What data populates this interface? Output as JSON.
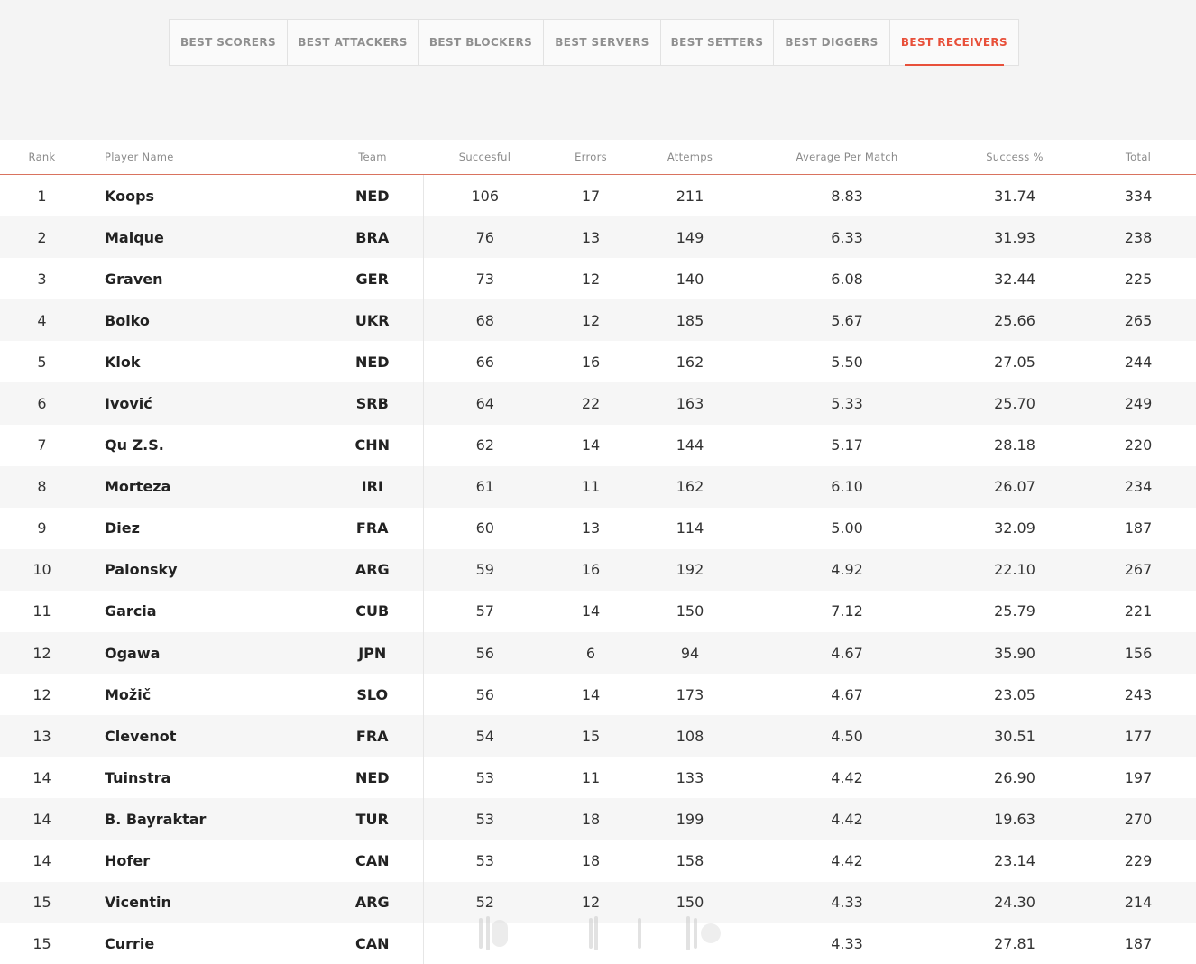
{
  "tabs": [
    {
      "label": "BEST SCORERS",
      "active": false
    },
    {
      "label": "BEST ATTACKERS",
      "active": false
    },
    {
      "label": "BEST BLOCKERS",
      "active": false
    },
    {
      "label": "BEST SERVERS",
      "active": false
    },
    {
      "label": "BEST SETTERS",
      "active": false
    },
    {
      "label": "BEST DIGGERS",
      "active": false
    },
    {
      "label": "BEST RECEIVERS",
      "active": true
    }
  ],
  "table": {
    "headers": {
      "rank": "Rank",
      "player": "Player Name",
      "team": "Team",
      "successful": "Succesful",
      "errors": "Errors",
      "attempts": "Attemps",
      "average": "Average Per Match",
      "success_pct": "Success %",
      "total": "Total"
    },
    "rows": [
      {
        "rank": "1",
        "player": "Koops",
        "team": "NED",
        "successful": "106",
        "errors": "17",
        "attempts": "211",
        "average": "8.83",
        "success_pct": "31.74",
        "total": "334"
      },
      {
        "rank": "2",
        "player": "Maique",
        "team": "BRA",
        "successful": "76",
        "errors": "13",
        "attempts": "149",
        "average": "6.33",
        "success_pct": "31.93",
        "total": "238"
      },
      {
        "rank": "3",
        "player": "Graven",
        "team": "GER",
        "successful": "73",
        "errors": "12",
        "attempts": "140",
        "average": "6.08",
        "success_pct": "32.44",
        "total": "225"
      },
      {
        "rank": "4",
        "player": "Boiko",
        "team": "UKR",
        "successful": "68",
        "errors": "12",
        "attempts": "185",
        "average": "5.67",
        "success_pct": "25.66",
        "total": "265"
      },
      {
        "rank": "5",
        "player": "Klok",
        "team": "NED",
        "successful": "66",
        "errors": "16",
        "attempts": "162",
        "average": "5.50",
        "success_pct": "27.05",
        "total": "244"
      },
      {
        "rank": "6",
        "player": "Ivović",
        "team": "SRB",
        "successful": "64",
        "errors": "22",
        "attempts": "163",
        "average": "5.33",
        "success_pct": "25.70",
        "total": "249"
      },
      {
        "rank": "7",
        "player": "Qu Z.S.",
        "team": "CHN",
        "successful": "62",
        "errors": "14",
        "attempts": "144",
        "average": "5.17",
        "success_pct": "28.18",
        "total": "220"
      },
      {
        "rank": "8",
        "player": "Morteza",
        "team": "IRI",
        "successful": "61",
        "errors": "11",
        "attempts": "162",
        "average": "6.10",
        "success_pct": "26.07",
        "total": "234"
      },
      {
        "rank": "9",
        "player": "Diez",
        "team": "FRA",
        "successful": "60",
        "errors": "13",
        "attempts": "114",
        "average": "5.00",
        "success_pct": "32.09",
        "total": "187"
      },
      {
        "rank": "10",
        "player": "Palonsky",
        "team": "ARG",
        "successful": "59",
        "errors": "16",
        "attempts": "192",
        "average": "4.92",
        "success_pct": "22.10",
        "total": "267"
      },
      {
        "rank": "11",
        "player": "Garcia",
        "team": "CUB",
        "successful": "57",
        "errors": "14",
        "attempts": "150",
        "average": "7.12",
        "success_pct": "25.79",
        "total": "221"
      },
      {
        "rank": "12",
        "player": "Ogawa",
        "team": "JPN",
        "successful": "56",
        "errors": "6",
        "attempts": "94",
        "average": "4.67",
        "success_pct": "35.90",
        "total": "156"
      },
      {
        "rank": "12",
        "player": "Možič",
        "team": "SLO",
        "successful": "56",
        "errors": "14",
        "attempts": "173",
        "average": "4.67",
        "success_pct": "23.05",
        "total": "243"
      },
      {
        "rank": "13",
        "player": "Clevenot",
        "team": "FRA",
        "successful": "54",
        "errors": "15",
        "attempts": "108",
        "average": "4.50",
        "success_pct": "30.51",
        "total": "177"
      },
      {
        "rank": "14",
        "player": "Tuinstra",
        "team": "NED",
        "successful": "53",
        "errors": "11",
        "attempts": "133",
        "average": "4.42",
        "success_pct": "26.90",
        "total": "197"
      },
      {
        "rank": "14",
        "player": "B. Bayraktar",
        "team": "TUR",
        "successful": "53",
        "errors": "18",
        "attempts": "199",
        "average": "4.42",
        "success_pct": "19.63",
        "total": "270"
      },
      {
        "rank": "14",
        "player": "Hofer",
        "team": "CAN",
        "successful": "53",
        "errors": "18",
        "attempts": "158",
        "average": "4.42",
        "success_pct": "23.14",
        "total": "229"
      },
      {
        "rank": "15",
        "player": "Vicentin",
        "team": "ARG",
        "successful": "52",
        "errors": "12",
        "attempts": "150",
        "average": "4.33",
        "success_pct": "24.30",
        "total": "214"
      },
      {
        "rank": "15",
        "player": "Currie",
        "team": "CAN",
        "successful": "",
        "errors": "",
        "attempts": "",
        "average": "4.33",
        "success_pct": "27.81",
        "total": "187"
      }
    ]
  },
  "colors": {
    "accent": "#e8503a",
    "page_bg": "#f4f4f4",
    "row_alt": "#f6f6f6"
  }
}
